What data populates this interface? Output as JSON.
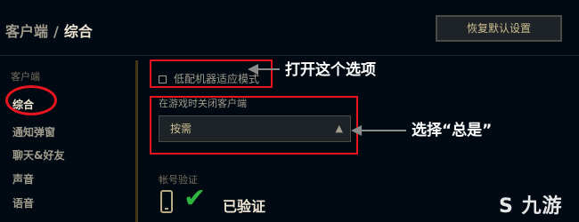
{
  "header": {
    "breadcrumb_parent": "客户端",
    "separator": "/",
    "breadcrumb_current": "综合",
    "reset_button": "恢复默认设置"
  },
  "sidebar": {
    "section_title": "客户端",
    "items": [
      {
        "label": "综合",
        "active": true
      },
      {
        "label": "通知弹窗"
      },
      {
        "label": "聊天&好友"
      },
      {
        "label": "声音"
      },
      {
        "label": "语音"
      }
    ]
  },
  "settings": {
    "low_spec_label": "低配机器适应模式",
    "low_spec_checked": false,
    "close_client_label": "在游戏时关闭客户端",
    "close_client_value": "按需",
    "account_verify_title": "帐号验证",
    "verified_label": "已验证"
  },
  "annotations": {
    "note1": "打开这个选项",
    "note2": "选择“总是”"
  },
  "watermark": "九游",
  "colors": {
    "annotation_red": "#e8141f",
    "gold_text": "#f0e6d2",
    "verified_green": "#2fb540"
  }
}
